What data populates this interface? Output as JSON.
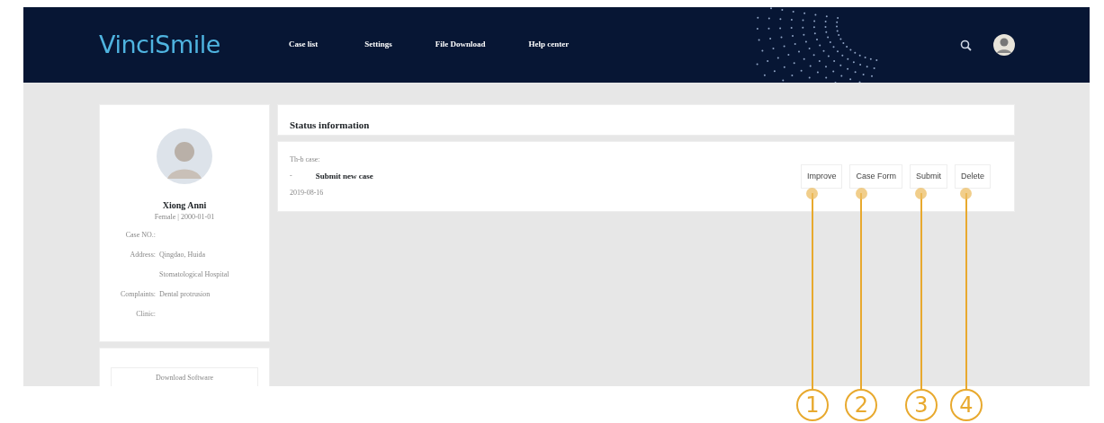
{
  "navbar": {
    "logo": "VinciSmile",
    "links": [
      {
        "label": "Case list",
        "selected": false
      },
      {
        "label": "Settings",
        "selected": false
      },
      {
        "label": "File Download",
        "selected": false
      },
      {
        "label": "Help center",
        "selected": false
      }
    ]
  },
  "patient": {
    "name": "Xiong Anni",
    "info": "Female | 2000-01-01",
    "fields": [
      {
        "label": "Case NO.:"
      },
      {
        "label": "Address:",
        "value": "Qingdao, Huida"
      },
      {
        "value": "Stomatological Hospital"
      },
      {
        "label": "Complaints:",
        "value": "Dental protrusion"
      },
      {
        "label": "Clinic:"
      }
    ],
    "button": "Download Software"
  },
  "status": {
    "title": "Status information",
    "case": {
      "caption": "Th-b case:",
      "marker": "-",
      "title": "Submit new case",
      "date": "2019-08-16",
      "actions": [
        "Improve",
        "Case Form",
        "Submit",
        "Delete"
      ]
    }
  },
  "callouts": [
    "1",
    "2",
    "3",
    "4"
  ]
}
